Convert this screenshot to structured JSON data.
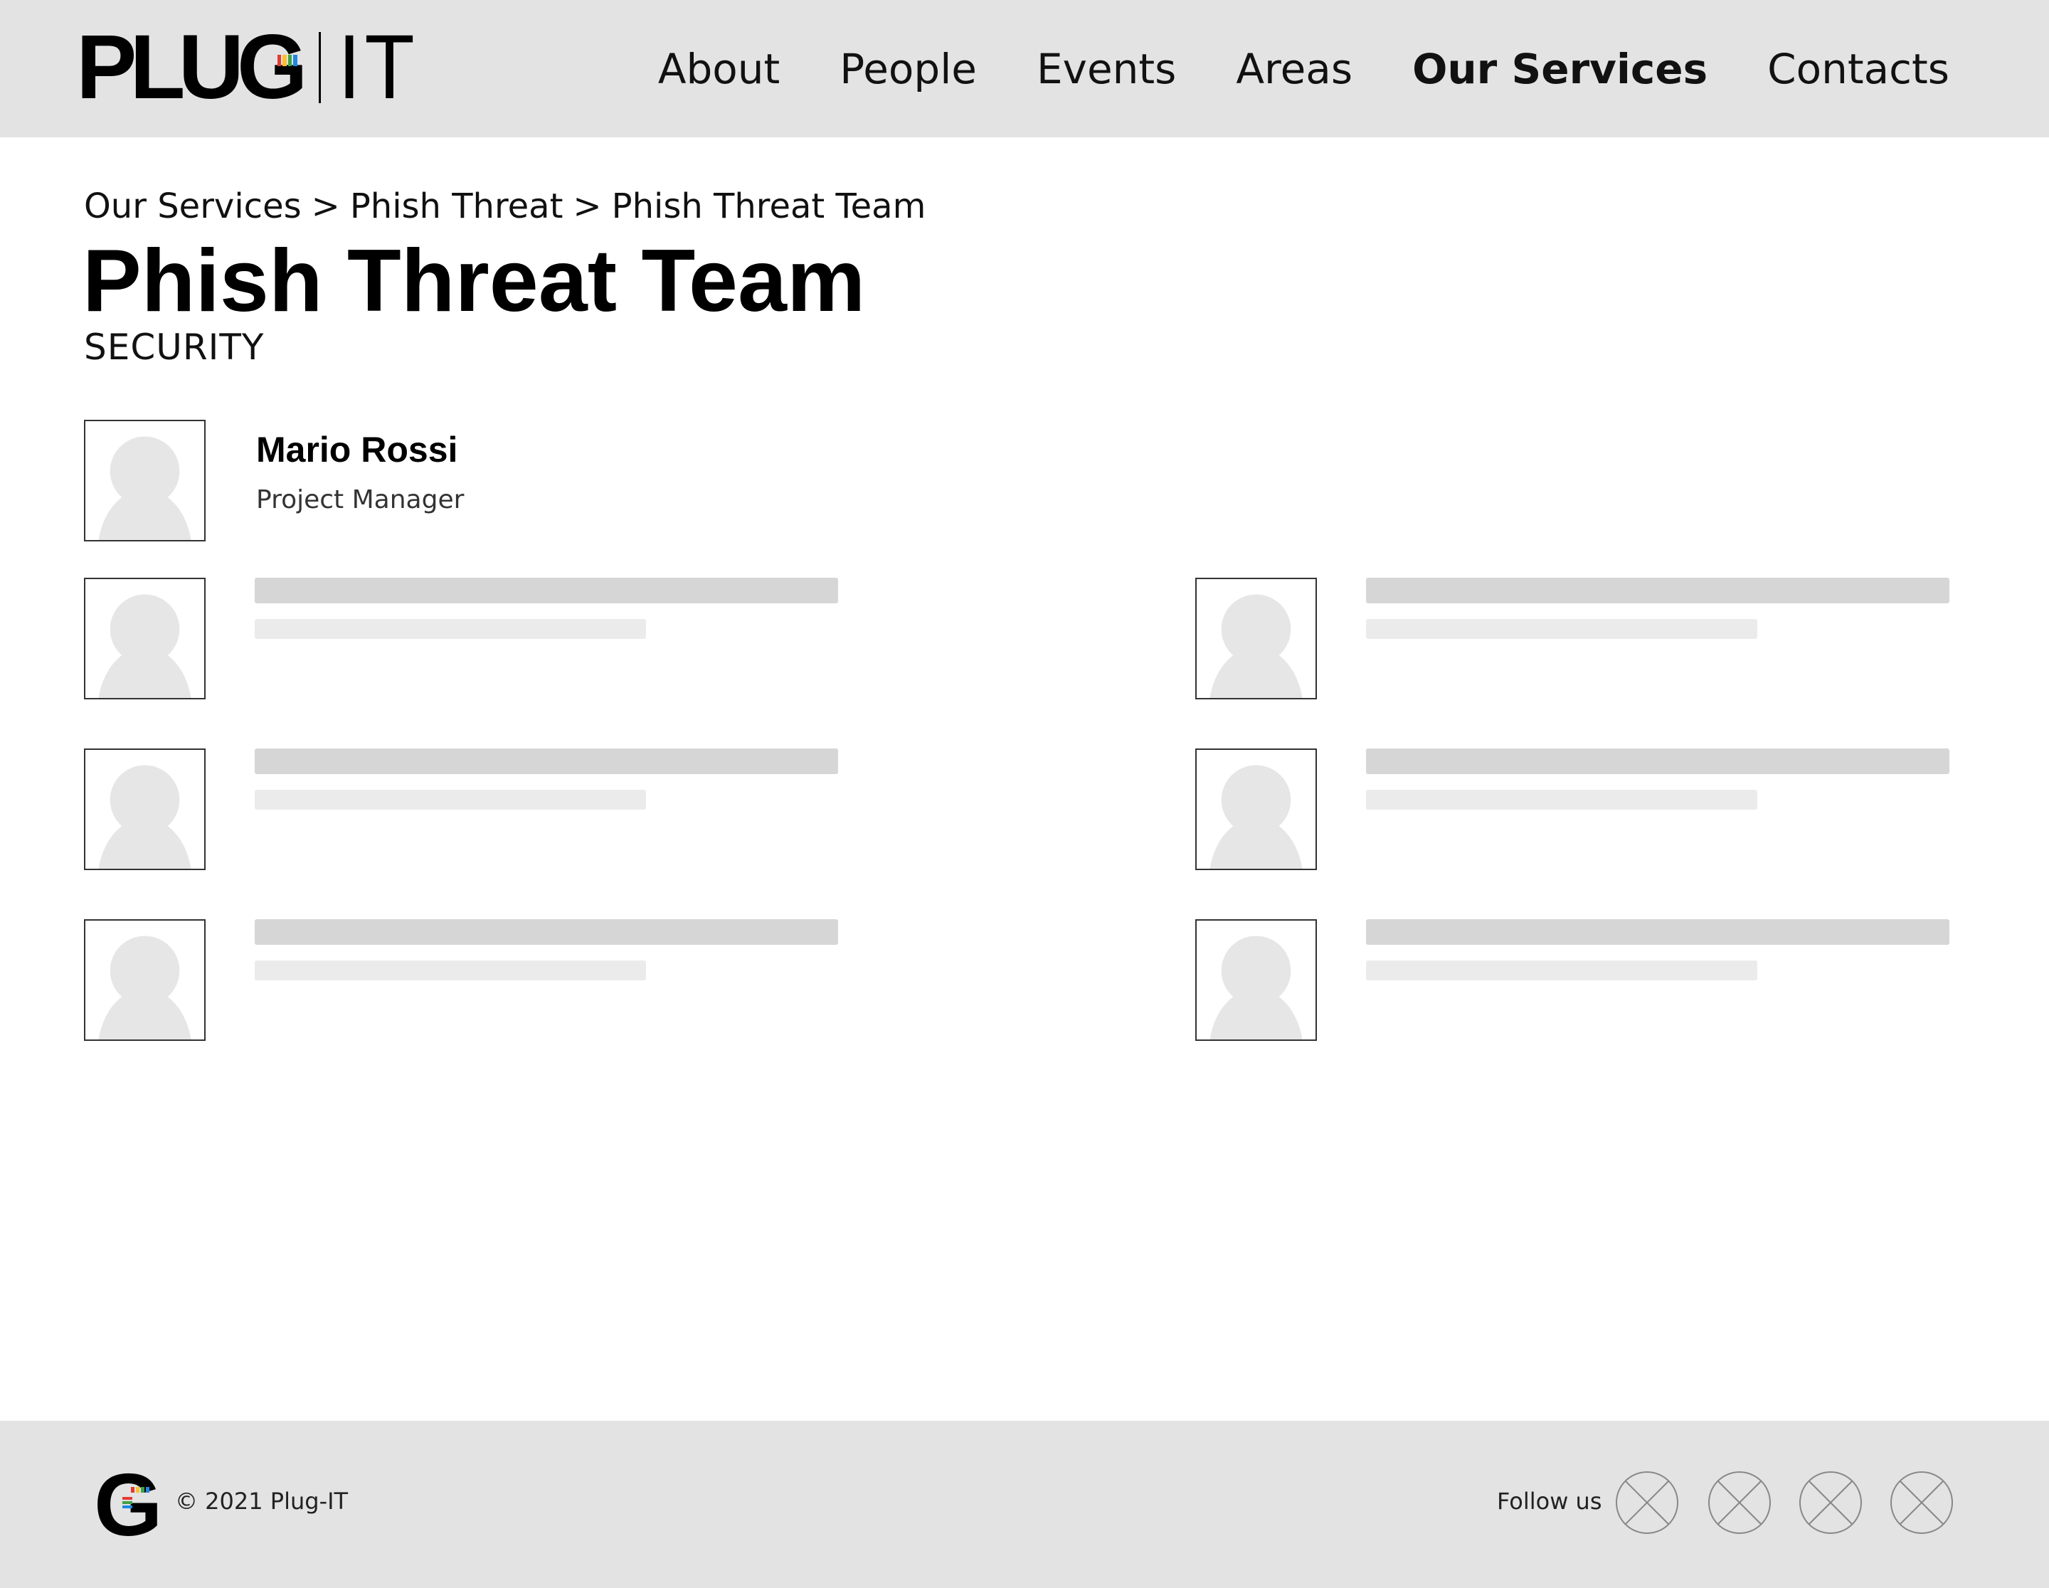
{
  "header": {
    "logo": {
      "main": "PLUG",
      "suffix": "IT",
      "stripe_colors": [
        "#e53935",
        "#fbc02d",
        "#43a047",
        "#1e88e5"
      ]
    },
    "nav": [
      {
        "label": "About",
        "active": false
      },
      {
        "label": "People",
        "active": false
      },
      {
        "label": "Events",
        "active": false
      },
      {
        "label": "Areas",
        "active": false
      },
      {
        "label": "Our Services",
        "active": true
      },
      {
        "label": "Contacts",
        "active": false
      }
    ]
  },
  "breadcrumb": {
    "items": [
      "Our Services",
      "Phish Threat",
      "Phish Threat Team"
    ],
    "separator": ">"
  },
  "page": {
    "title": "Phish Threat Team",
    "subtitle": "SECURITY"
  },
  "team": {
    "lead": {
      "name": "Mario Rossi",
      "role": "Project Manager",
      "avatar_icon": "user-placeholder-icon"
    },
    "placeholder_members": 6
  },
  "footer": {
    "copyright": "© 2021 Plug-IT",
    "follow_label": "Follow us",
    "social_icons": [
      "social-link-1-icon",
      "social-link-2-icon",
      "social-link-3-icon",
      "social-link-4-icon"
    ]
  },
  "colors": {
    "header_bg": "#e3e3e3",
    "footer_bg": "#e3e3e3",
    "skeleton_dark": "#d6d6d6",
    "skeleton_light": "#ebebeb",
    "avatar_silhouette": "#e6e6e6"
  }
}
